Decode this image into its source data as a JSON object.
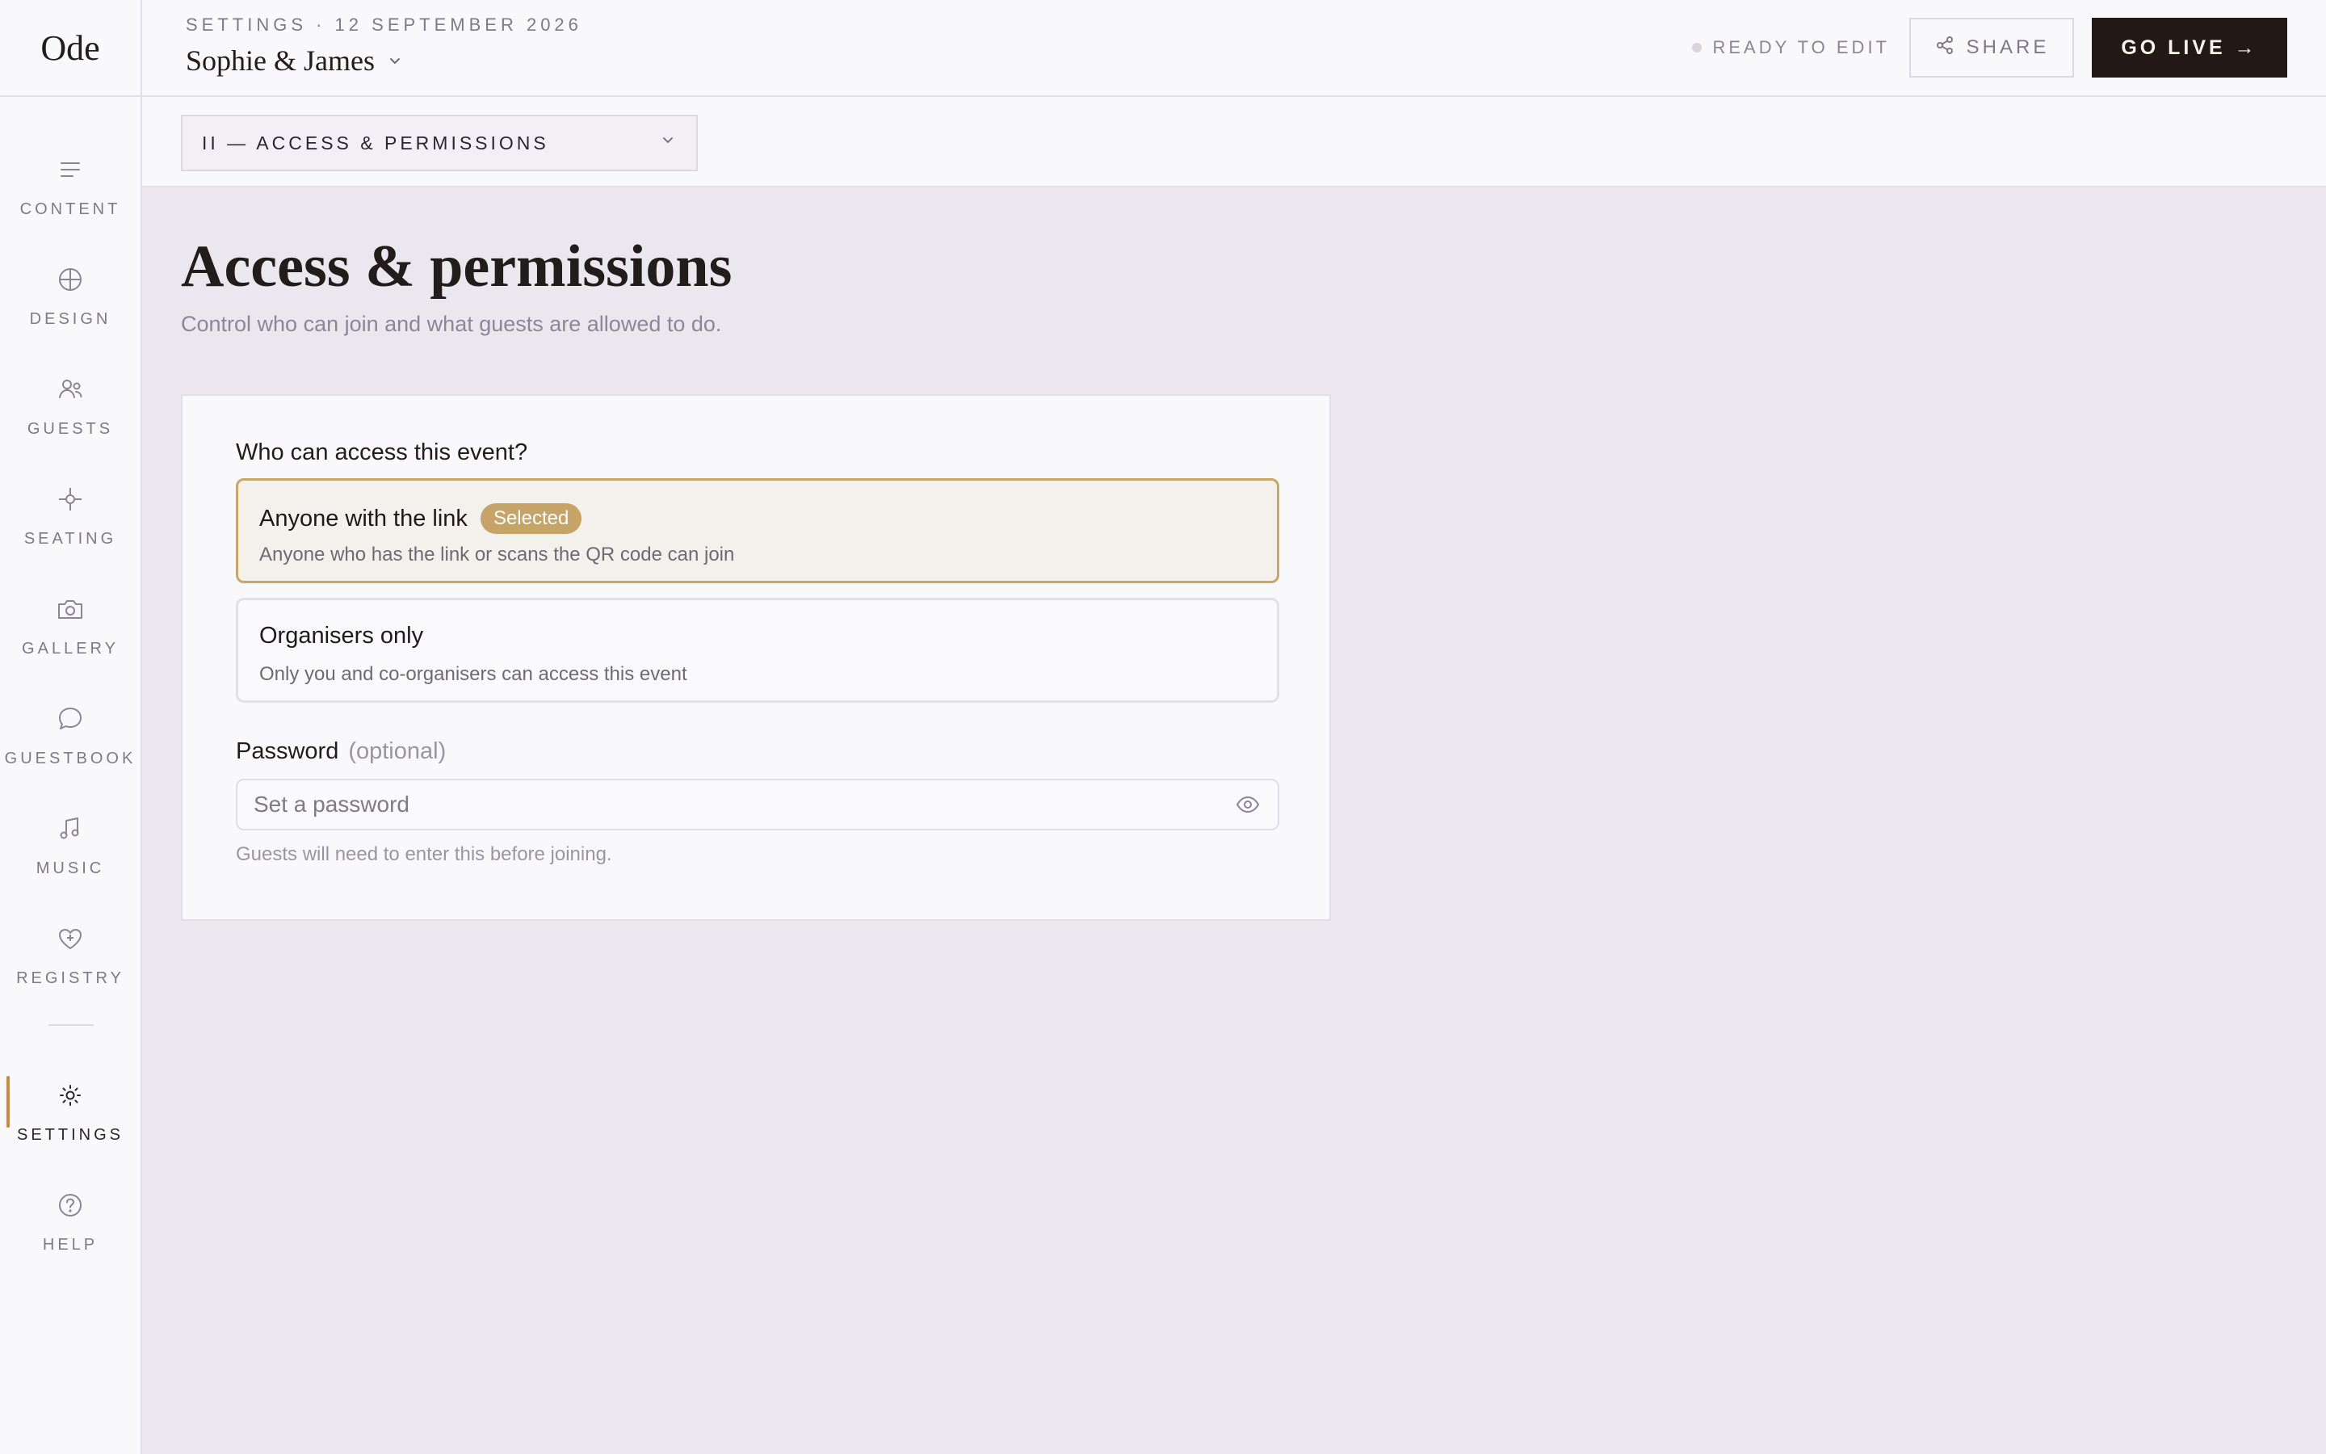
{
  "app": {
    "logo": "Ode"
  },
  "sidebar": {
    "items": [
      {
        "label": "CONTENT",
        "icon": "content-lines-icon"
      },
      {
        "label": "DESIGN",
        "icon": "design-compass-icon"
      },
      {
        "label": "GUESTS",
        "icon": "guests-people-icon"
      },
      {
        "label": "SEATING",
        "icon": "seating-nodes-icon"
      },
      {
        "label": "GALLERY",
        "icon": "gallery-camera-icon"
      },
      {
        "label": "GUESTBOOK",
        "icon": "guestbook-bubble-icon"
      },
      {
        "label": "MUSIC",
        "icon": "music-note-icon"
      },
      {
        "label": "REGISTRY",
        "icon": "registry-heart-icon"
      }
    ],
    "bottom_items": [
      {
        "label": "SETTINGS",
        "icon": "settings-gear-icon",
        "active": true
      },
      {
        "label": "HELP",
        "icon": "help-circle-icon"
      }
    ]
  },
  "header": {
    "breadcrumb": "SETTINGS · 12 SEPTEMBER 2026",
    "event_name": "Sophie & James",
    "status": "READY TO EDIT",
    "share_label": "SHARE",
    "go_live_label": "GO LIVE →"
  },
  "section_select": {
    "value": "II — ACCESS & PERMISSIONS"
  },
  "page": {
    "title": "Access & permissions",
    "subtitle": "Control who can join and what guests are allowed to do."
  },
  "access": {
    "question": "Who can access this event?",
    "options": [
      {
        "title": "Anyone with the link",
        "badge": "Selected",
        "description": "Anyone who has the link or scans the QR code can join"
      },
      {
        "title": "Organisers only",
        "description": "Only you and co-organisers can access this event"
      }
    ]
  },
  "password": {
    "label": "Password",
    "optional": "(optional)",
    "placeholder": "Set a password",
    "value": "",
    "hint": "Guests will need to enter this before joining."
  },
  "colors": {
    "accent": "#c88b3f",
    "selected_border": "#c6a96a",
    "badge": "#c6a467",
    "primary_button": "#221816"
  }
}
